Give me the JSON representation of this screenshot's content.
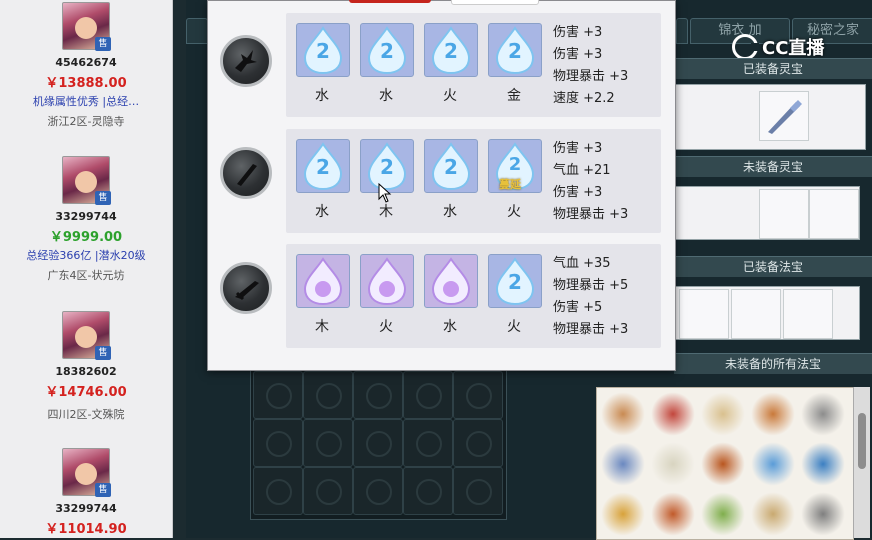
{
  "listings": [
    {
      "id": "45462674",
      "price": "￥13888.00",
      "price_color": "#d4221f",
      "desc": "机缘属性优秀 |总经…",
      "server": "浙江2区-灵隐寺",
      "tag": "售"
    },
    {
      "id": "33299744",
      "price": "￥9999.00",
      "price_color": "#2ca12c",
      "desc": "总经验366亿 |潜水20级",
      "server": "广东4区-状元坊",
      "tag": "售"
    },
    {
      "id": "18382602",
      "price": "￥14746.00",
      "price_color": "#d4221f",
      "desc": "",
      "server": "四川2区-文殊院",
      "tag": "售"
    },
    {
      "id": "33299744",
      "price": "￥11014.90",
      "price_color": "#d4221f",
      "desc": "",
      "server": "",
      "tag": "售"
    }
  ],
  "game": {
    "tabs": [
      "锦衣",
      "加",
      "秘密之家"
    ],
    "sections": {
      "equipped_lingbao": "已装备灵宝",
      "unequipped_lingbao": "未装备灵宝",
      "equipped_fabao": "已装备法宝",
      "all_unequipped_fabao": "未装备的所有法宝"
    },
    "logo_text": "CC直播"
  },
  "popup": {
    "sets": [
      {
        "weapon_icon": "bird-claw-icon",
        "gems": [
          {
            "element": "水",
            "type": "blue-drop",
            "badge": ""
          },
          {
            "element": "水",
            "type": "blue-drop",
            "badge": ""
          },
          {
            "element": "火",
            "type": "blue-drop",
            "badge": ""
          },
          {
            "element": "金",
            "type": "blue-drop",
            "badge": ""
          }
        ],
        "stats": [
          "伤害 +3",
          "伤害 +3",
          "物理暴击 +3",
          "速度 +2.2"
        ]
      },
      {
        "weapon_icon": "dagger-icon",
        "gems": [
          {
            "element": "水",
            "type": "blue-drop",
            "badge": ""
          },
          {
            "element": "木",
            "type": "blue-drop",
            "badge": ""
          },
          {
            "element": "水",
            "type": "blue-drop",
            "badge": ""
          },
          {
            "element": "火",
            "type": "blue-drop",
            "badge": "蔓延"
          }
        ],
        "stats": [
          "伤害 +3",
          "气血 +21",
          "伤害 +3",
          "物理暴击 +3"
        ]
      },
      {
        "weapon_icon": "sword-icon",
        "gems": [
          {
            "element": "木",
            "type": "purple-drop",
            "badge": ""
          },
          {
            "element": "火",
            "type": "purple-drop",
            "badge": ""
          },
          {
            "element": "水",
            "type": "purple-drop",
            "badge": ""
          },
          {
            "element": "火",
            "type": "blue-drop",
            "badge": ""
          }
        ],
        "stats": [
          "气血 +35",
          "物理暴击 +5",
          "伤害 +5",
          "物理暴击 +3"
        ]
      }
    ]
  },
  "colors": {
    "popup_bg": "#f4f4f6",
    "gem_panel_bg": "#e4e4ea",
    "game_bg": "#17282e",
    "price_red": "#d4221f",
    "price_green": "#2ca12c"
  }
}
